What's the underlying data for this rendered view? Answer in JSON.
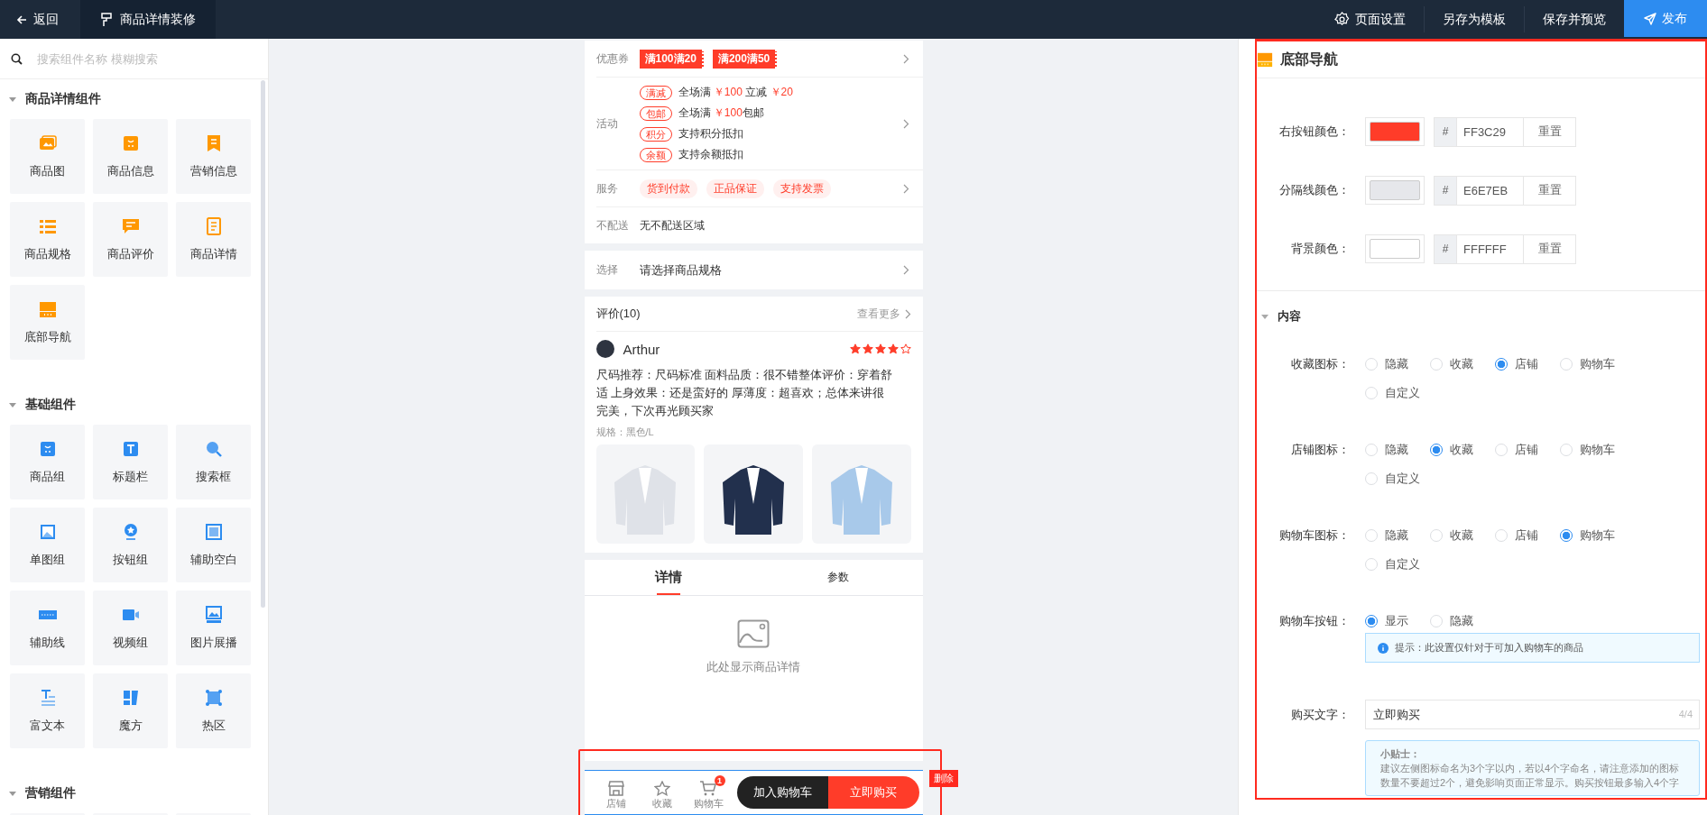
{
  "topbar": {
    "back": "返回",
    "title": "商品详情装修",
    "actions": [
      {
        "label": "页面设置",
        "kind": "settings"
      },
      {
        "label": "另存为模板",
        "kind": "plain"
      },
      {
        "label": "保存并预览",
        "kind": "plain"
      },
      {
        "label": "发布",
        "kind": "primary"
      }
    ]
  },
  "sidebar": {
    "search": {
      "placeholder": "搜索组件名称 模糊搜索"
    },
    "groups": [
      {
        "title": "商品详情组件",
        "expanded": true,
        "color": "#ff9800",
        "items": [
          {
            "label": "商品图",
            "kind": "image"
          },
          {
            "label": "商品信息",
            "kind": "bag"
          },
          {
            "label": "营销信息",
            "kind": "bookmark"
          },
          {
            "label": "商品规格",
            "kind": "list"
          },
          {
            "label": "商品评价",
            "kind": "comment"
          },
          {
            "label": "商品详情",
            "kind": "doc"
          },
          {
            "label": "底部导航",
            "kind": "nav"
          }
        ]
      },
      {
        "title": "基础组件",
        "expanded": true,
        "color": "#2d8cf0",
        "items": [
          {
            "label": "商品组",
            "kind": "bag"
          },
          {
            "label": "标题栏",
            "kind": "title"
          },
          {
            "label": "搜索框",
            "kind": "search"
          },
          {
            "label": "单图组",
            "kind": "picture"
          },
          {
            "label": "按钮组",
            "kind": "badge"
          },
          {
            "label": "辅助空白",
            "kind": "blank"
          },
          {
            "label": "辅助线",
            "kind": "line"
          },
          {
            "label": "视频组",
            "kind": "video"
          },
          {
            "label": "图片展播",
            "kind": "carousel"
          },
          {
            "label": "富文本",
            "kind": "richtext"
          },
          {
            "label": "魔方",
            "kind": "cube"
          },
          {
            "label": "热区",
            "kind": "hotspot"
          }
        ]
      },
      {
        "title": "营销组件",
        "expanded": true,
        "items": [
          {
            "kind": "cutoff"
          },
          {
            "kind": "cutoff"
          },
          {
            "kind": "cutoff"
          }
        ]
      }
    ]
  },
  "preview": {
    "coupons": {
      "label": "优惠券",
      "tags": [
        "满100满20",
        "满200满50"
      ]
    },
    "activities": {
      "label": "活动",
      "items": [
        {
          "tag": "满减",
          "text": "全场满 **￥100** 立减 **￥20**"
        },
        {
          "tag": "包邮",
          "text": "全场满 **￥100**包邮"
        },
        {
          "tag": "积分",
          "text": "支持积分抵扣"
        },
        {
          "tag": "余额",
          "text": "支持余额抵扣"
        }
      ]
    },
    "services": {
      "label": "服务",
      "tags": [
        "货到付款",
        "正品保证",
        "支持发票"
      ]
    },
    "no_delivery": {
      "label": "不配送",
      "value": "无不配送区域"
    },
    "spec": {
      "label": "选择",
      "value": "请选择商品规格"
    },
    "reviews": {
      "title": "评价(10)",
      "more": "查看更多",
      "author": "Arthur",
      "stars": 4,
      "text": "尺码推荐：尺码标准 面料品质：很不错整体评价：穿着舒适 上身效果：还是蛮好的 厚薄度：超喜欢；总体来讲很完美，下次再光顾买家",
      "spec": "规格：黑色/L",
      "photos": [
        {
          "color": "#dfe2e8"
        },
        {
          "color": "#22304d"
        },
        {
          "color": "#a8c9ea"
        }
      ]
    },
    "tabs": [
      {
        "label": "详情",
        "selected": true
      },
      {
        "label": "参数",
        "selected": false
      }
    ],
    "detail_placeholder": "此处显示商品详情",
    "bottom_nav": {
      "selected": true,
      "delete_label": "删除",
      "icons": [
        {
          "label": "店铺",
          "kind": "store"
        },
        {
          "label": "收藏",
          "kind": "star"
        },
        {
          "label": "购物车",
          "kind": "cart",
          "badge": "1"
        }
      ],
      "cart_button": "加入购物车",
      "buy_button": "立即购买"
    }
  },
  "settings": {
    "title": "底部导航",
    "colors": [
      {
        "label": "右按钮颜色：",
        "color": "#ff3c29",
        "prefix": "#",
        "hex": "FF3C29",
        "reset": "重置"
      },
      {
        "label": "分隔线颜色：",
        "color": "#e6e7eb",
        "prefix": "#",
        "hex": "E6E7EB",
        "reset": "重置"
      },
      {
        "label": "背景颜色：",
        "color": "#ffffff",
        "prefix": "#",
        "hex": "FFFFFF",
        "reset": "重置"
      }
    ],
    "section": {
      "title": "内容",
      "expanded": true
    },
    "radio_groups": [
      {
        "label": "收藏图标：",
        "options": [
          {
            "label": "隐藏",
            "selected": false
          },
          {
            "label": "收藏",
            "selected": false
          },
          {
            "label": "店铺",
            "selected": true
          },
          {
            "label": "购物车",
            "selected": false
          },
          {
            "label": "自定义",
            "selected": false
          }
        ]
      },
      {
        "label": "店铺图标：",
        "options": [
          {
            "label": "隐藏",
            "selected": false
          },
          {
            "label": "收藏",
            "selected": true
          },
          {
            "label": "店铺",
            "selected": false
          },
          {
            "label": "购物车",
            "selected": false
          },
          {
            "label": "自定义",
            "selected": false
          }
        ]
      },
      {
        "label": "购物车图标：",
        "options": [
          {
            "label": "隐藏",
            "selected": false
          },
          {
            "label": "收藏",
            "selected": false
          },
          {
            "label": "店铺",
            "selected": false
          },
          {
            "label": "购物车",
            "selected": true
          },
          {
            "label": "自定义",
            "selected": false
          }
        ]
      },
      {
        "label": "购物车按钮：",
        "options": [
          {
            "label": "显示",
            "selected": true
          },
          {
            "label": "隐藏",
            "selected": false
          }
        ],
        "hint": "提示：此设置仅针对于可加入购物车的商品"
      }
    ],
    "buy_text": {
      "label": "购买文字：",
      "value": "立即购买",
      "count": "4/4"
    },
    "tips": {
      "title": "小贴士：",
      "text": "建议左侧图标命名为3个字以内，若以4个字命名，请注意添加的图标数量不要超过2个，避免影响页面正常显示。购买按钮最多输入4个字"
    }
  }
}
